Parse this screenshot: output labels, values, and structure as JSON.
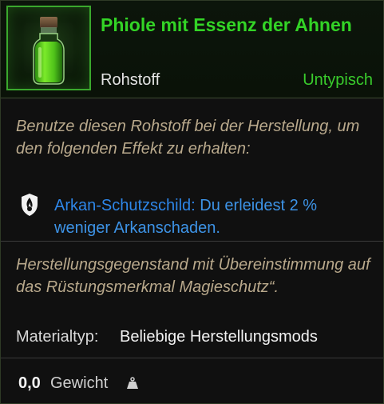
{
  "item": {
    "name": "Phiole mit Essenz der Ahnen",
    "category": "Rohstoff",
    "rarity": "Untypisch",
    "icon": "green-vial-icon"
  },
  "description": "Benutze diesen Rohstoff bei der Herstellung, um den folgenden Effekt zu erhalten:",
  "effect": {
    "icon": "arcane-ward-icon",
    "name": "Arkan-Schutzschild:",
    "text": " Du erleidest 2 % weniger Arkanschaden."
  },
  "crafting_note": "Herstellungsgegenstand mit Übereinstimmung auf das Rüstungsmerkmal Magieschutz“.",
  "material": {
    "label": "Materialtyp:",
    "value": "Beliebige Herstellungsmods"
  },
  "weight": {
    "value": "0,0",
    "label": "Gewicht",
    "icon": "weight-icon"
  },
  "colors": {
    "item_name": "#33d426",
    "rarity": "#39cc2c",
    "effect": "#2e86e8",
    "flavor_text": "#b9a98c",
    "icon_border": "#3aa82d"
  }
}
